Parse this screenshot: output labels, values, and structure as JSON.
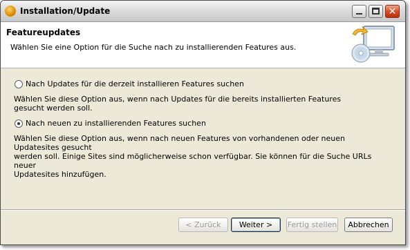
{
  "window": {
    "title": "Installation/Update"
  },
  "banner": {
    "title": "Featureupdates",
    "description": "Wählen Sie eine Option für die Suche nach zu installierenden Features aus.",
    "icon": "cd-monitor-update-icon"
  },
  "options": [
    {
      "label": "Nach Updates für die derzeit installieren Features suchen",
      "description": "Wählen Sie diese Option aus, wenn nach Updates für die bereits installierten Features gesucht werden soll.",
      "selected": false
    },
    {
      "label": "Nach neuen zu installierenden Features suchen",
      "description_lines": [
        "Wählen Sie diese Option aus, wenn nach neuen Features von vorhandenen oder neuen Updatesites gesucht",
        "werden soll. Einige Sites sind möglicherweise schon verfügbar. Sie können für die Suche URLs neuer",
        "Updatesites hinzufügen."
      ],
      "selected": true
    }
  ],
  "buttons": {
    "back": "< Zurück",
    "next": "Weiter >",
    "finish": "Fertig stellen",
    "cancel": "Abbrechen"
  }
}
